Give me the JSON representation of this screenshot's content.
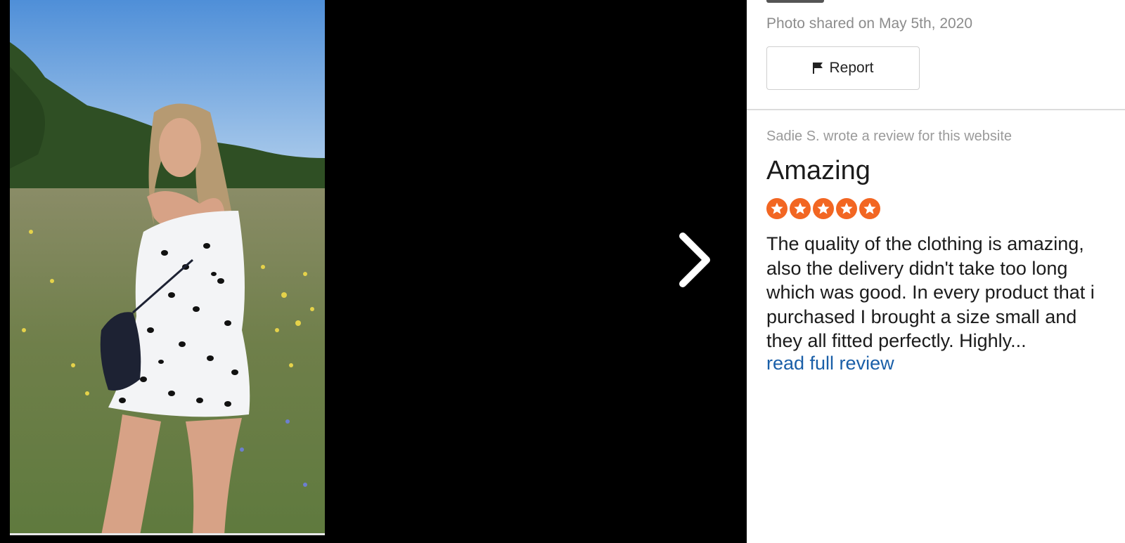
{
  "photo": {
    "alt": "Customer photo"
  },
  "navigation": {
    "next_icon": "chevron-right-icon"
  },
  "sidebar": {
    "shared_text": "Photo shared on May 5th, 2020",
    "report_label": "Report",
    "report_icon": "flag-icon"
  },
  "review": {
    "byline": "Sadie S. wrote a review for this website",
    "title": "Amazing",
    "rating": 5,
    "rating_max": 5,
    "star_color": "#f26622",
    "body": "The quality of the clothing is amazing, also the delivery didn't take too long which was good. In every product that i purchased I brought a size small and they all fitted perfectly. Highly...",
    "read_more": "read full review",
    "link_color": "#1a5fa8"
  }
}
